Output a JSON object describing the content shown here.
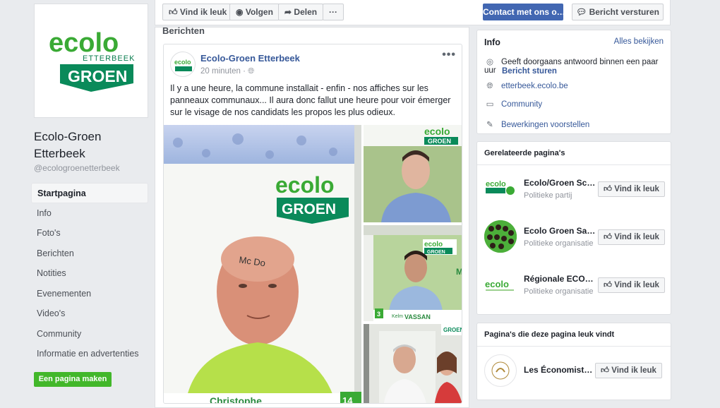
{
  "page": {
    "name": "Ecolo-Groen Etterbeek",
    "handle": "@ecologroenetterbeek",
    "logo": {
      "ecolo": "ecolo",
      "etterbeek": "ETTERBEEK",
      "groen": "GROEN"
    },
    "create_button": "Een pagina maken"
  },
  "nav": [
    {
      "label": "Startpagina",
      "active": true
    },
    {
      "label": "Info"
    },
    {
      "label": "Foto's"
    },
    {
      "label": "Berichten"
    },
    {
      "label": "Notities"
    },
    {
      "label": "Evenementen"
    },
    {
      "label": "Video's"
    },
    {
      "label": "Community"
    },
    {
      "label": "Informatie en advertenties"
    }
  ],
  "actionbar": {
    "like": "Vind ik leuk",
    "follow": "Volgen",
    "share": "Delen",
    "more": "···",
    "contact": "Contact met ons o…",
    "message": "Bericht versturen"
  },
  "posts": {
    "title": "Berichten",
    "post": {
      "author": "Ecolo-Groen Etterbeek",
      "time": "20 minuten",
      "text": "Il y a une heure, la commune installait - enfin - nos affiches sur les panneaux communaux... Il aura donc fallut une heure pour voir émerger sur le visage de nos candidats les propos les plus odieux.",
      "poster_text": {
        "ecolo": "ecolo",
        "groen": "GROEN",
        "forehead": "Mc Do",
        "name": "Christophe",
        "number": "14",
        "kelm": "Kelm",
        "kelm_last": "VASSAN",
        "small_ecolo": "ecolo",
        "small_groen": "GROEN",
        "number2": "3",
        "m": "M"
      }
    }
  },
  "info": {
    "title": "Info",
    "see_all": "Alles bekijken",
    "response": "Geeft doorgaans antwoord binnen een paar uur",
    "send_message": "Bericht sturen",
    "website": "etterbeek.ecolo.be",
    "category": "Community",
    "suggest": "Bewerkingen voorstellen"
  },
  "related": {
    "title": "Gerelateerde pagina's",
    "items": [
      {
        "name": "Ecolo/Groen Sc…",
        "sub": "Politieke partij",
        "like": "Vind ik leuk"
      },
      {
        "name": "Ecolo Groen Sa…",
        "sub": "Politieke organisatie",
        "like": "Vind ik leuk"
      },
      {
        "name": "Régionale ECO…",
        "sub": "Politieke organisatie",
        "like": "Vind ik leuk"
      }
    ]
  },
  "liked": {
    "title": "Pagina's die deze pagina leuk vindt",
    "items": [
      {
        "name": "Les Économist…",
        "like": "Vind ik leuk"
      }
    ]
  },
  "colors": {
    "fb_blue": "#4267b2",
    "link": "#365899",
    "ecolo_green": "#3aaa35",
    "groen_teal": "#0a8a5a",
    "create_green": "#42b72a"
  }
}
